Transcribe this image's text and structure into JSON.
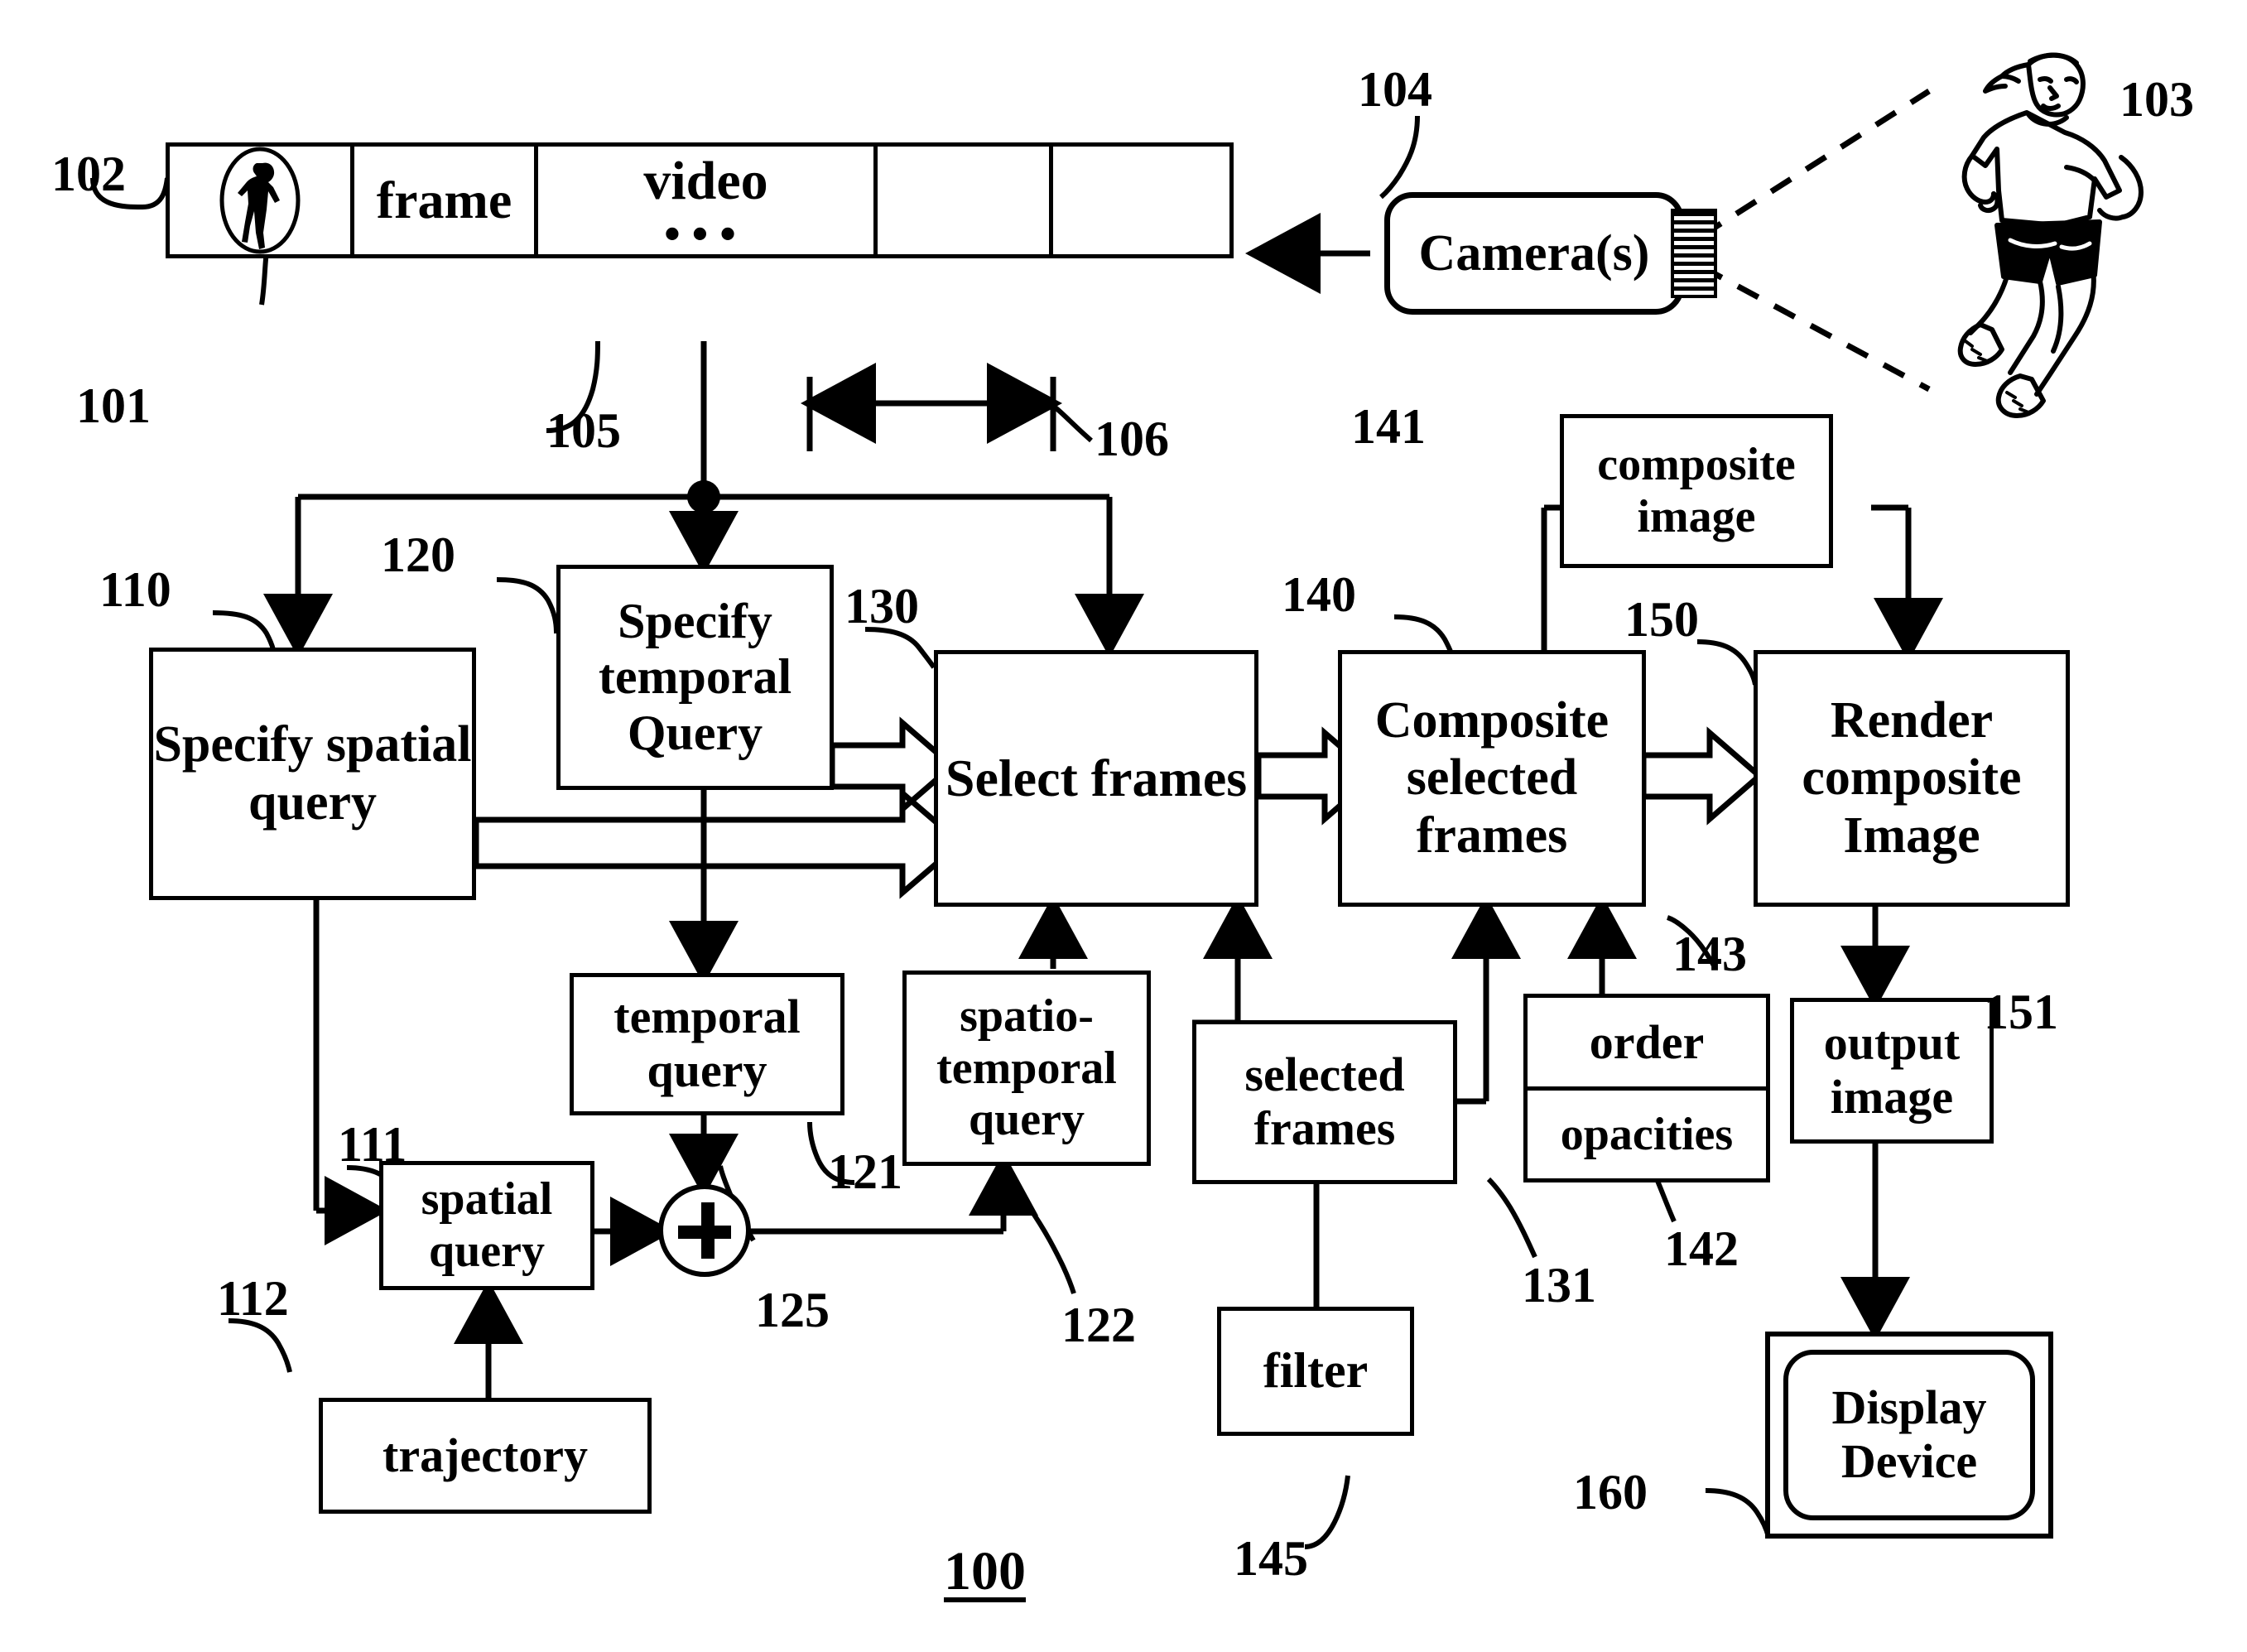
{
  "figure": {
    "title": "100",
    "media_strip": {
      "ref_strip": "102",
      "ref_thumb": "101",
      "ref_frame": "105",
      "ref_interval": "106",
      "cells": [
        {
          "label": "",
          "icon": "runner-thumbnail-icon"
        },
        {
          "label": "frame",
          "icon": ""
        },
        {
          "label": "video",
          "icon": "ellipsis-icon"
        },
        {
          "label": "",
          "icon": ""
        },
        {
          "label": "",
          "icon": ""
        }
      ]
    },
    "camera": {
      "label": "Camera(s)",
      "ref": "104"
    },
    "subject": {
      "ref": "103",
      "icon": "running-woman-figure"
    },
    "process_boxes": [
      {
        "id": "specify-spatial-query",
        "label": "Specify spatial query",
        "ref": "110"
      },
      {
        "id": "specify-temporal-query",
        "label": "Specify temporal Query",
        "ref": "120"
      },
      {
        "id": "select-frames",
        "label": "Select frames",
        "ref": "130"
      },
      {
        "id": "composite-selected-frames",
        "label": "Composite selected frames",
        "ref": "140"
      },
      {
        "id": "render-composite-image",
        "label": "Render composite Image",
        "ref": "150"
      }
    ],
    "data_boxes": [
      {
        "id": "spatial-query",
        "label": "spatial query",
        "ref": "111"
      },
      {
        "id": "trajectory",
        "label": "trajectory",
        "ref": "112"
      },
      {
        "id": "temporal-query",
        "label": "temporal query",
        "ref": "121"
      },
      {
        "id": "spatio-temporal-query",
        "label": "spatio-temporal query",
        "ref": "122"
      },
      {
        "id": "selected-frames",
        "label": "selected frames",
        "ref": "131"
      },
      {
        "id": "filter",
        "label": "filter",
        "ref": "145"
      },
      {
        "id": "composite-image",
        "label": "composite image",
        "ref": "141"
      },
      {
        "id": "output-image",
        "label": "output image",
        "ref": "151"
      }
    ],
    "order_opacities": {
      "id": "order-opacities",
      "top_label": "order",
      "bottom_label": "opacities",
      "ref_top": "143",
      "ref_bottom": "142"
    },
    "display_device": {
      "label": "Display Device",
      "ref": "160"
    },
    "adder": {
      "symbol": "+",
      "ref": "125"
    }
  }
}
